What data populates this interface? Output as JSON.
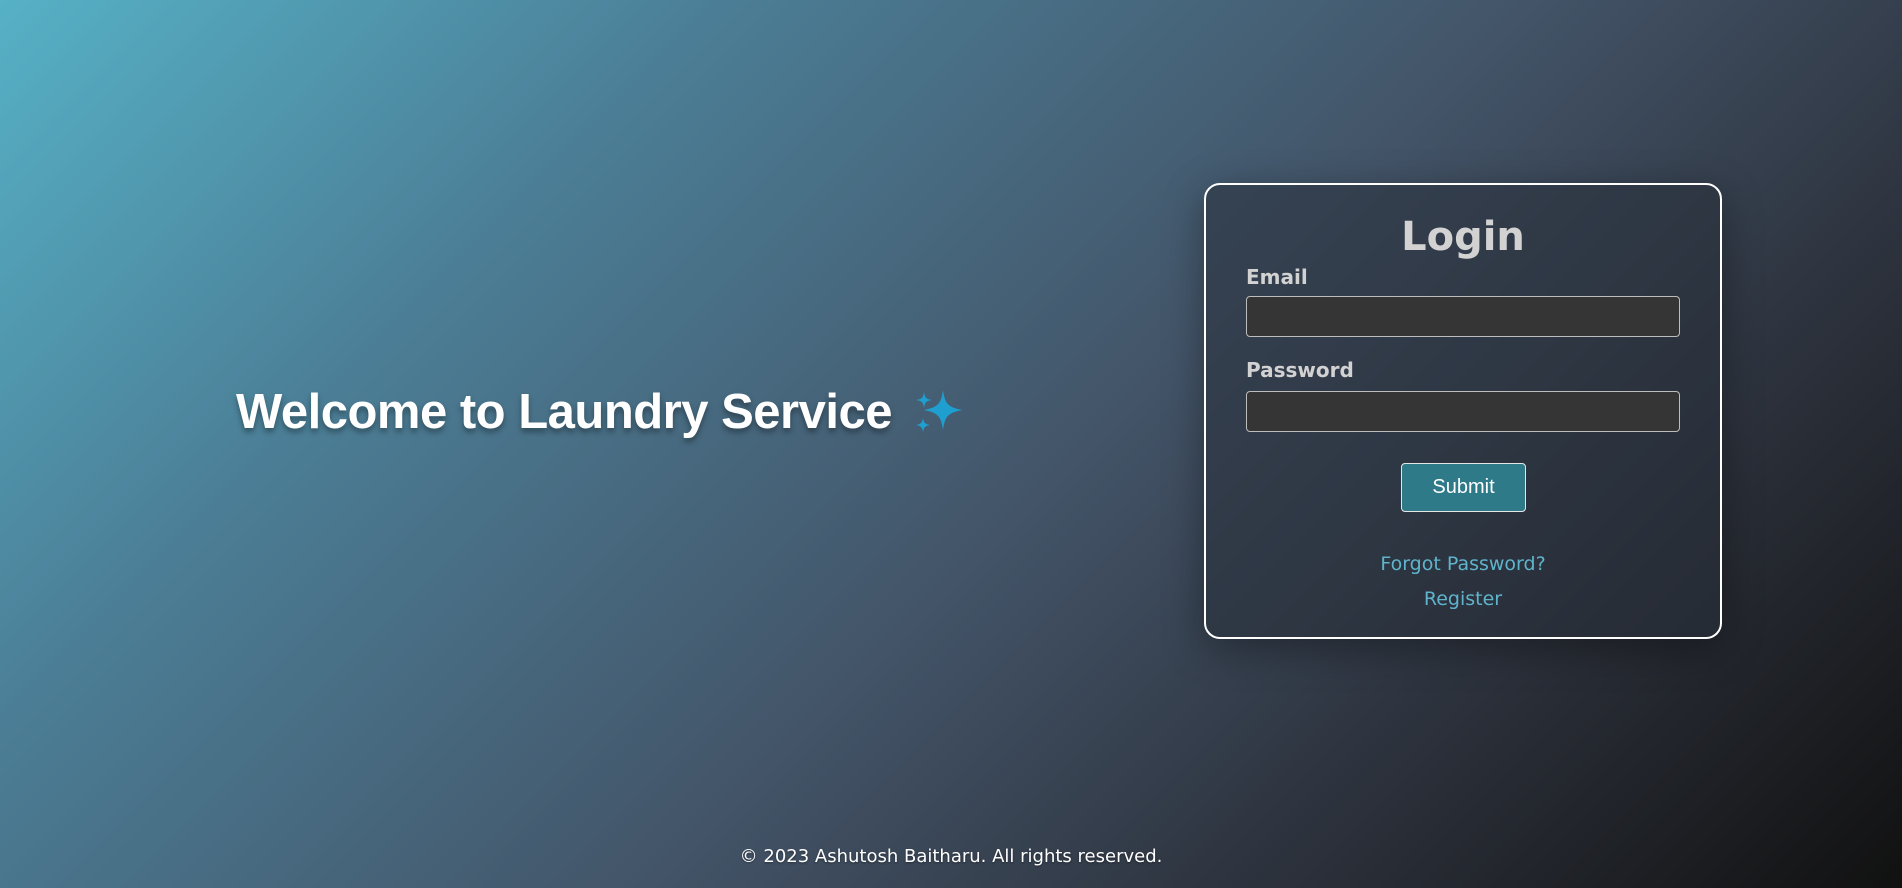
{
  "hero": {
    "welcome_text": "Welcome to Laundry Service",
    "icon": "sparkles-icon",
    "icon_color": "#1e9fd0"
  },
  "login": {
    "title": "Login",
    "email_label": "Email",
    "email_value": "",
    "password_label": "Password",
    "password_value": "",
    "submit_label": "Submit",
    "forgot_password_label": "Forgot Password?",
    "register_label": "Register"
  },
  "footer": {
    "copyright": "© 2023 Ashutosh Baitharu. All rights reserved."
  },
  "colors": {
    "accent": "#2f7a89",
    "link": "#5fb4cc",
    "input_bg": "#353535"
  }
}
